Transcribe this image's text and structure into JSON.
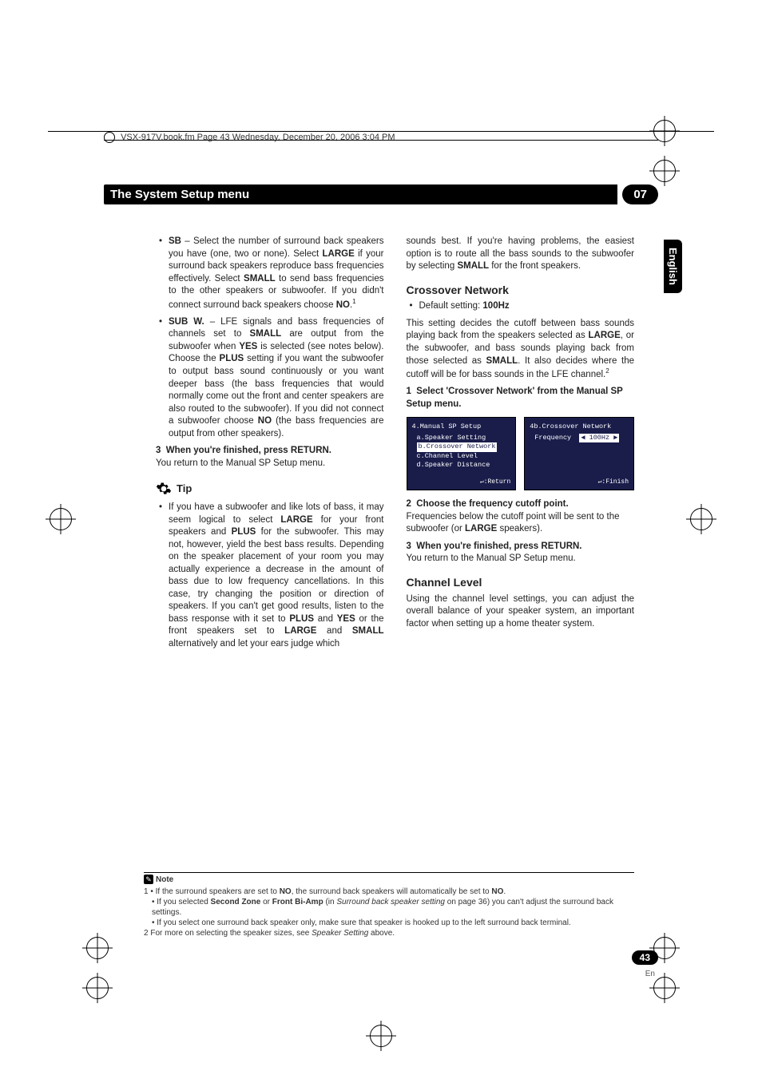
{
  "header": {
    "running_head": "VSX-917V.book.fm  Page 43  Wednesday, December 20, 2006  3:04 PM"
  },
  "title_bar": {
    "title": "The System Setup menu",
    "chapter": "07"
  },
  "lang_tab": "English",
  "left_col": {
    "sb_label": "SB",
    "sb_text_a": " – Select the number of surround back speakers you have (one, two or none). Select ",
    "sb_bold_large": "LARGE",
    "sb_text_b": " if your surround back speakers reproduce bass frequencies effectively. Select ",
    "sb_bold_small": "SMALL",
    "sb_text_c": " to send bass frequencies to the other speakers or subwoofer. If you didn't connect surround back speakers choose ",
    "sb_bold_no": "NO",
    "sb_text_d": ".",
    "subw_label": "SUB W.",
    "subw_text_a": " – LFE signals and bass frequencies of channels set to ",
    "subw_bold_small": "SMALL",
    "subw_text_b": " are output from the subwoofer when ",
    "subw_bold_yes": "YES",
    "subw_text_c": " is selected (see notes below). Choose the ",
    "subw_bold_plus": "PLUS",
    "subw_text_d": " setting if you want the subwoofer to output bass sound continuously or you want deeper bass (the bass frequencies that would normally come out the front and center speakers are also routed to the subwoofer). If you did not connect a subwoofer choose ",
    "subw_bold_no": "NO",
    "subw_text_e": " (the bass frequencies are output from other speakers).",
    "step3_num": "3",
    "step3_bold": "When you're finished, press RETURN.",
    "step3_body": "You return to the Manual SP Setup menu.",
    "tip_label": "Tip",
    "tip_text_a": "If you have a subwoofer and like lots of bass, it may seem logical to select ",
    "tip_bold_large": "LARGE",
    "tip_text_b": " for your front speakers and ",
    "tip_bold_plus": "PLUS",
    "tip_text_c": " for the subwoofer. This may not, however, yield the best bass results. Depending on the speaker placement of your room you may actually experience a decrease in the amount of bass due to low frequency cancellations. In this case, try changing the position or direction of speakers. If you can't get good results, listen to the bass response with it set to ",
    "tip_bold_plus2": "PLUS",
    "tip_text_d": " and ",
    "tip_bold_yes": "YES",
    "tip_text_e": " or the front speakers set to ",
    "tip_bold_large2": "LARGE",
    "tip_text_f": " and ",
    "tip_bold_small": "SMALL",
    "tip_text_g": " alternatively and let your ears judge which"
  },
  "right_col": {
    "cont_a": "sounds best. If you're having problems, the easiest option is to route all the bass sounds to the subwoofer by selecting ",
    "cont_bold_small": "SMALL",
    "cont_b": " for the front speakers.",
    "cross_heading": "Crossover Network",
    "cross_default_label": "Default setting: ",
    "cross_default_value": "100Hz",
    "cross_body_a": "This setting decides the cutoff between bass sounds playing back from the speakers selected as ",
    "cross_bold_large": "LARGE",
    "cross_body_b": ", or the subwoofer, and bass sounds playing back from those selected as ",
    "cross_bold_small": "SMALL",
    "cross_body_c": ". It also decides where the cutoff will be for bass sounds in the LFE channel.",
    "cross_step1_num": "1",
    "cross_step1_bold": "Select 'Crossover Network' from the Manual SP Setup menu.",
    "osd_left": {
      "title": "4.Manual SP Setup",
      "a": "a.Speaker Setting",
      "b": "b.Crossover Network",
      "c": "c.Channel Level",
      "d": "d.Speaker Distance",
      "footer": "↵:Return"
    },
    "osd_right": {
      "title": "4b.Crossover Network",
      "line": "Frequency",
      "value": "◀ 100Hz ▶",
      "footer": "↵:Finish"
    },
    "cross_step2_num": "2",
    "cross_step2_bold": "Choose the frequency cutoff point.",
    "cross_step2_body_a": "Frequencies below the cutoff point will be sent to the subwoofer (or ",
    "cross_step2_bold_large": "LARGE",
    "cross_step2_body_b": " speakers).",
    "cross_step3_num": "3",
    "cross_step3_bold": "When you're finished, press RETURN.",
    "cross_step3_body": "You return to the Manual SP Setup menu.",
    "chan_heading": "Channel Level",
    "chan_body": "Using the channel level settings, you can adjust the overall balance of your speaker system, an important factor when setting up a home theater system."
  },
  "footnotes": {
    "note_label": "Note",
    "n1_a": "1 • If the surround speakers are set to ",
    "n1_bold_no1": "NO",
    "n1_b": ", the surround back speakers will automatically be set to ",
    "n1_bold_no2": "NO",
    "n1_c": ".",
    "n1_line2_a": "• If you selected ",
    "n1_bold_sz": "Second Zone",
    "n1_line2_b": " or ",
    "n1_bold_fba": "Front Bi-Amp",
    "n1_line2_c": " (in ",
    "n1_ital": "Surround back speaker setting",
    "n1_line2_d": " on page 36) you can't adjust the surround back settings.",
    "n1_line3": "• If you select one surround back speaker only, make sure that speaker is hooked up to the left surround back terminal.",
    "n2_a": "2 For more on selecting the speaker sizes, see ",
    "n2_ital": "Speaker Setting",
    "n2_b": " above."
  },
  "page": {
    "number": "43",
    "lang": "En"
  }
}
